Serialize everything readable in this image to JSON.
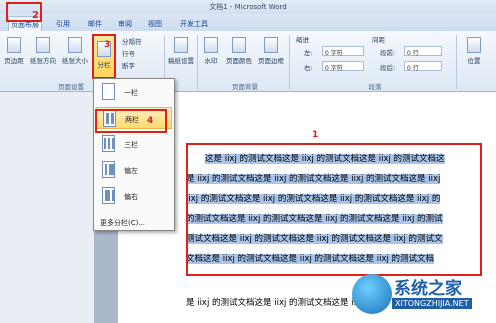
{
  "window": {
    "title": "文档1 - Microsoft Word"
  },
  "tabs": [
    {
      "label": "页面布局",
      "active": true
    },
    {
      "label": "引用"
    },
    {
      "label": "邮件"
    },
    {
      "label": "审阅"
    },
    {
      "label": "视图"
    },
    {
      "label": "开发工具"
    }
  ],
  "ribbon": {
    "page_setup": {
      "buttons": [
        "页边距",
        "纸张方向",
        "纸张大小",
        "分栏"
      ],
      "small": [
        "分隔符",
        "行号",
        "断字"
      ],
      "group_label": "页面设置"
    },
    "manuscript": {
      "label": "稿纸设置"
    },
    "page_bg": {
      "buttons": [
        "水印",
        "页面颜色",
        "页面边框"
      ],
      "group_label": "页面背景"
    },
    "indent": {
      "title": "缩进",
      "left_label": "左:",
      "left_value": "0 字符",
      "right_label": "右:",
      "right_value": "0 字符"
    },
    "spacing": {
      "title": "间距",
      "before_label": "段前:",
      "before_value": "0 行",
      "after_label": "段后:",
      "after_value": "0 行"
    },
    "paragraph_label": "段落",
    "position_label": "位置"
  },
  "dropdown": {
    "items": [
      "一栏",
      "两栏",
      "三栏",
      "偏左",
      "偏右"
    ],
    "more": "更多分栏(C)..."
  },
  "annotations": {
    "one": "1",
    "two": "2",
    "three": "3",
    "four": "4"
  },
  "document": {
    "lines": [
      "这是 iixj 的测试文档这是 iixj 的测试文档这是 iixj 的测试文档这",
      "是 iixj 的测试文档这是 iixj 的测试文档这是 iixj 的测试文档这是 iixj",
      "iixj 的测试文档这是 iixj 的测试文档这是 iixj 的测试文档这是 iixj 的",
      "的测试文档这是 iixj 的测试文档这是 iixj 的测试文档这是 iixj 的测试",
      "测试文档这是 iixj 的测试文档这是 iixj 的测试文档这是 iixj 的测试文",
      "文档这是 iixj 的测试文档这是 iixj 的测试文档这是 iixj 的测试文档",
      "是 iixj 的测试文档这是 iixj 的测试文档这是 iixj"
    ]
  },
  "watermark": {
    "name": "系统之家",
    "url": "XITONGZHIJIA.NET"
  }
}
